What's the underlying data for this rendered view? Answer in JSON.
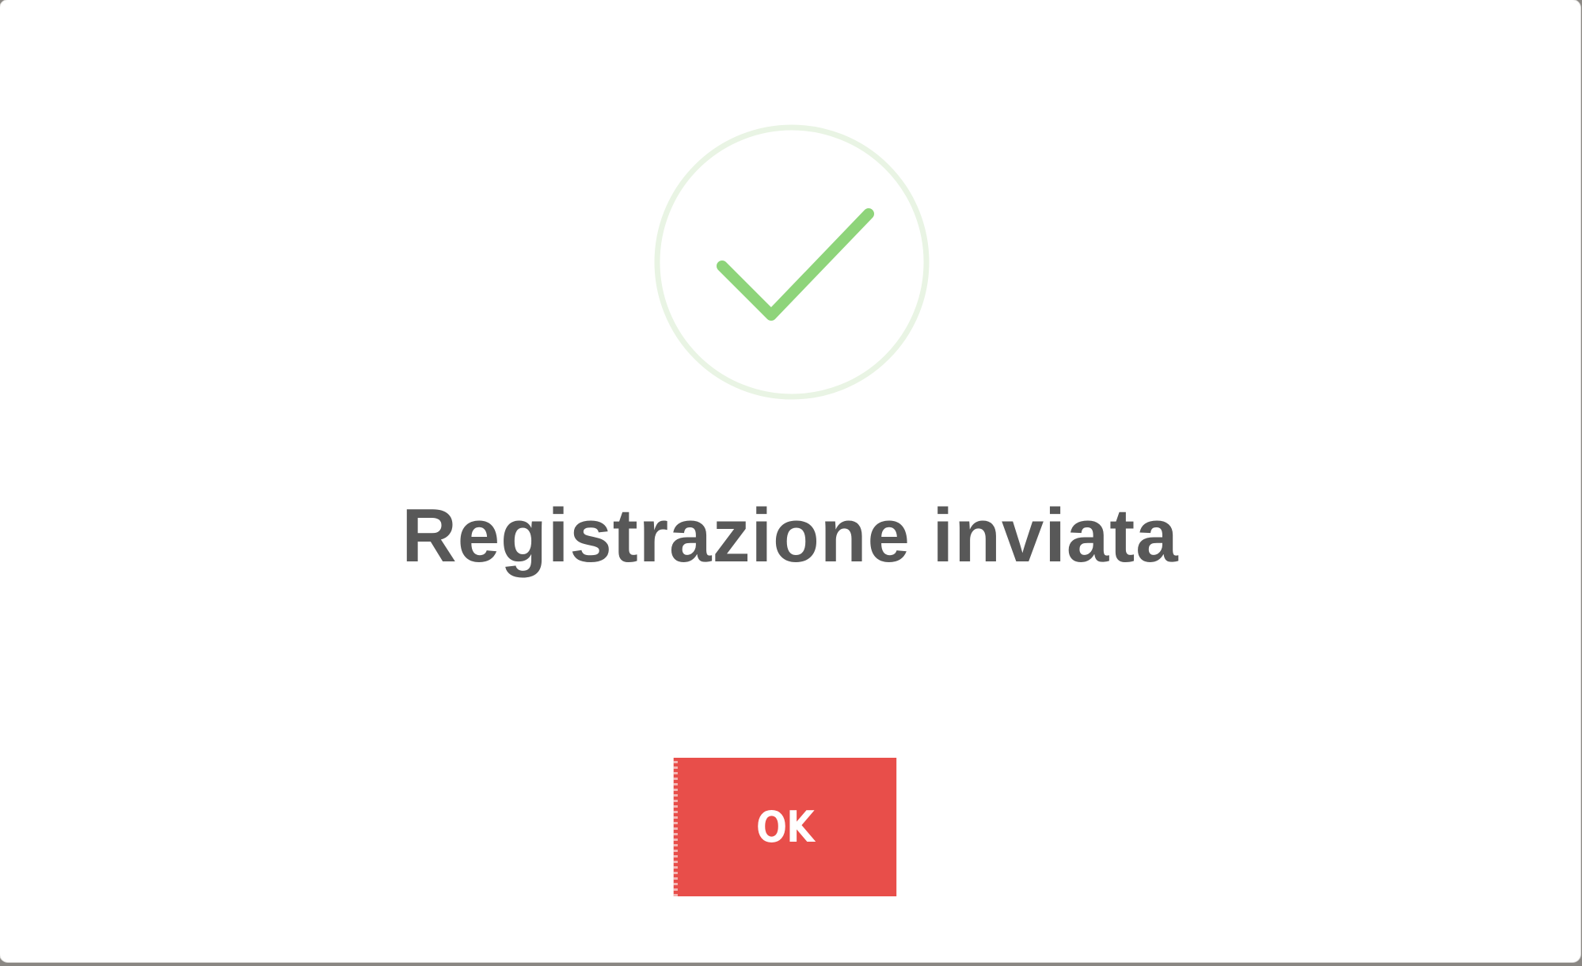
{
  "dialog": {
    "title": "Registrazione inviata",
    "ok_label": "OK",
    "icon": "checkmark-icon",
    "colors": {
      "check": "#8ed47a",
      "ring": "#e9f4e4",
      "button": "#e84e4a",
      "title": "#585858"
    }
  }
}
